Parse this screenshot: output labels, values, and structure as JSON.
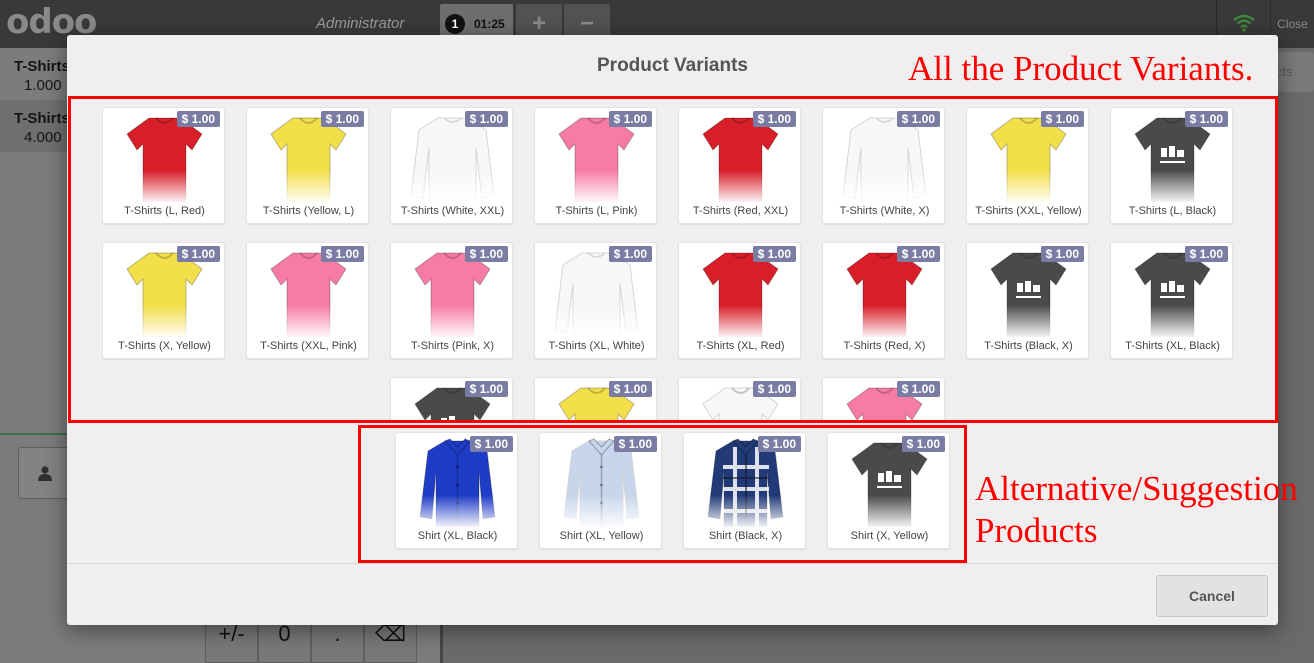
{
  "pos": {
    "logo": "odoo",
    "user": "Administrator",
    "order_number": "1",
    "order_time": "01:25",
    "add_order": "+",
    "remove_order": "−",
    "close_label": "Close",
    "search_placeholder": "cts",
    "order_lines": [
      {
        "name": "T-Shirts",
        "qty": "1.000"
      },
      {
        "name": "T-Shirts",
        "qty": "4.000"
      }
    ],
    "numpad_visible": [
      "+/-",
      "0",
      ".",
      "⌫"
    ]
  },
  "modal": {
    "title": "Product Variants",
    "cancel_label": "Cancel"
  },
  "colors": {
    "red": "#d81e28",
    "yellow": "#f2df4a",
    "white": "#f7f7f7",
    "pink": "#f77ca4",
    "black": "#4a4a4a",
    "royal_blue": "#1e3cc6",
    "light_blue": "#c7d6ec",
    "plaid": "#223a78",
    "price_badge": "#7b7ca4",
    "annotation": "#ff0000"
  },
  "products": [
    {
      "name": "T-Shirts (L, Red)",
      "price": "$ 1.00",
      "color": "red",
      "kind": "tee"
    },
    {
      "name": "T-Shirts (Yellow, L)",
      "price": "$ 1.00",
      "color": "yellow",
      "kind": "tee"
    },
    {
      "name": "T-Shirts (White, XXL)",
      "price": "$ 1.00",
      "color": "white",
      "kind": "long"
    },
    {
      "name": "T-Shirts (L, Pink)",
      "price": "$ 1.00",
      "color": "pink",
      "kind": "tee"
    },
    {
      "name": "T-Shirts (Red, XXL)",
      "price": "$ 1.00",
      "color": "red",
      "kind": "tee"
    },
    {
      "name": "T-Shirts (White, X)",
      "price": "$ 1.00",
      "color": "white",
      "kind": "long"
    },
    {
      "name": "T-Shirts (XXL, Yellow)",
      "price": "$ 1.00",
      "color": "yellow",
      "kind": "tee"
    },
    {
      "name": "T-Shirts (L, Black)",
      "price": "$ 1.00",
      "color": "black",
      "kind": "tee-print"
    },
    {
      "name": "T-Shirts (X, Yellow)",
      "price": "$ 1.00",
      "color": "yellow",
      "kind": "tee"
    },
    {
      "name": "T-Shirts (XXL, Pink)",
      "price": "$ 1.00",
      "color": "pink",
      "kind": "tee"
    },
    {
      "name": "T-Shirts (Pink, X)",
      "price": "$ 1.00",
      "color": "pink",
      "kind": "tee"
    },
    {
      "name": "T-Shirts (XL, White)",
      "price": "$ 1.00",
      "color": "white",
      "kind": "long"
    },
    {
      "name": "T-Shirts (XL, Red)",
      "price": "$ 1.00",
      "color": "red",
      "kind": "tee"
    },
    {
      "name": "T-Shirts (Red, X)",
      "price": "$ 1.00",
      "color": "red",
      "kind": "tee"
    },
    {
      "name": "T-Shirts (Black, X)",
      "price": "$ 1.00",
      "color": "black",
      "kind": "tee-print"
    },
    {
      "name": "T-Shirts (XL, Black)",
      "price": "$ 1.00",
      "color": "black",
      "kind": "tee-print"
    },
    {
      "name": "",
      "price": "$ 1.00",
      "color": "black",
      "kind": "tee-print"
    },
    {
      "name": "",
      "price": "$ 1.00",
      "color": "yellow",
      "kind": "tee"
    },
    {
      "name": "",
      "price": "$ 1.00",
      "color": "white",
      "kind": "tee"
    },
    {
      "name": "",
      "price": "$ 1.00",
      "color": "pink",
      "kind": "tee"
    }
  ],
  "alternatives": [
    {
      "name": "Shirt (XL, Black)",
      "price": "$ 1.00",
      "color": "royal_blue",
      "kind": "dress"
    },
    {
      "name": "Shirt (XL, Yellow)",
      "price": "$ 1.00",
      "color": "light_blue",
      "kind": "dress"
    },
    {
      "name": "Shirt (Black, X)",
      "price": "$ 1.00",
      "color": "plaid",
      "kind": "plaid"
    },
    {
      "name": "Shirt (X, Yellow)",
      "price": "$ 1.00",
      "color": "black",
      "kind": "tee-print"
    }
  ],
  "annotations": {
    "variants": "All the Product Variants.",
    "alternatives_line1": "Alternative/Suggestion",
    "alternatives_line2": "Products"
  }
}
